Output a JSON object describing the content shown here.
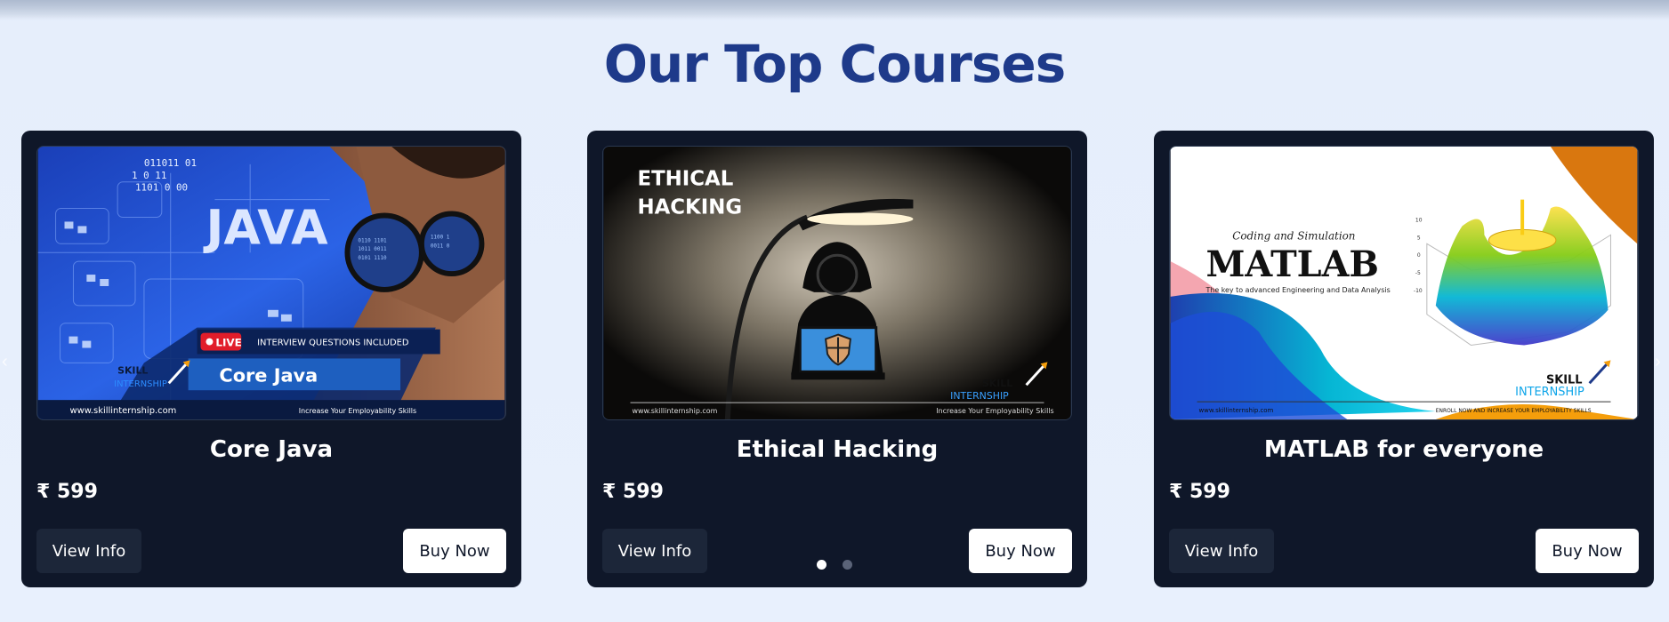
{
  "section": {
    "title": "Our Top Courses"
  },
  "courses": [
    {
      "title": "Core Java",
      "price": "₹ 599",
      "view_label": "View Info",
      "buy_label": "Buy Now",
      "banner": {
        "headline": "JAVA",
        "live_badge": "LIVE",
        "tagline": "INTERVIEW QUESTIONS INCLUDED",
        "course_name": "Core Java",
        "brand_top": "SKILL",
        "brand_bottom": "INTERNSHIP",
        "website": "www.skillinternship.com",
        "footer_tag": "Increase Your Employability Skills",
        "binary_1": "011011   01",
        "binary_2": "1   0   11",
        "binary_3": "1101  0   00"
      }
    },
    {
      "title": "Ethical Hacking",
      "price": "₹ 599",
      "view_label": "View Info",
      "buy_label": "Buy Now",
      "banner": {
        "headline_1": "ETHICAL",
        "headline_2": "HACKING",
        "brand_top": "SKILL",
        "brand_bottom": "INTERNSHIP",
        "website": "www.skillinternship.com",
        "footer_tag": "Increase Your Employability Skills"
      }
    },
    {
      "title": "MATLAB for everyone",
      "price": "₹ 599",
      "view_label": "View Info",
      "buy_label": "Buy Now",
      "banner": {
        "kicker": "Coding and Simulation",
        "headline": "MATLAB",
        "subline": "The key to advanced Engineering and Data Analysis",
        "brand_top": "SKILL",
        "brand_bottom": "INTERNSHIP",
        "website": "www.skillinternship.com",
        "footer_tag": "ENROLL NOW AND INCREASE YOUR EMPLOYABILITY SKILLS",
        "axis_ticks": [
          "10",
          "5",
          "0",
          "-5",
          "-10"
        ]
      }
    }
  ],
  "carousel": {
    "slide_count": 2,
    "active_slide": 1
  },
  "icons": [
    "chevron-left-icon",
    "chevron-right-icon",
    "rocket-logo-icon",
    "hooded-hacker-icon",
    "shield-icon"
  ],
  "colors": {
    "title": "#1e3a8a",
    "card_bg": "#0f1729",
    "info_button": "#1c2639",
    "buy_button": "#ffffff",
    "java_blue": "#1d4fd8",
    "live_red": "#e11d2a"
  }
}
